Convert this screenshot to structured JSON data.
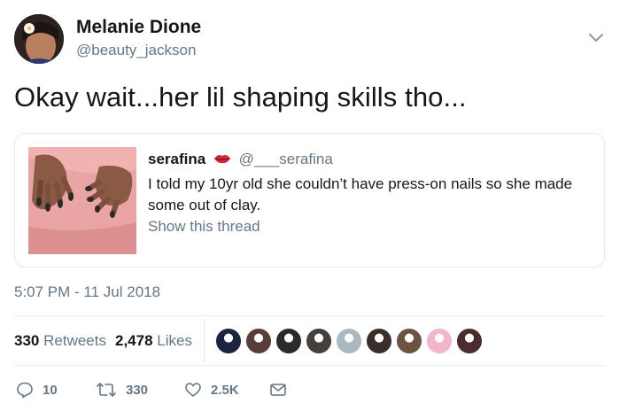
{
  "author": {
    "name": "Melanie Dione",
    "handle": "@beauty_jackson",
    "avatar_icon": "profile-photo"
  },
  "tweet": {
    "text": "Okay wait...her lil shaping skills tho..."
  },
  "quoted": {
    "name": "serafina",
    "emoji_icon": "lips-emoji",
    "handle": "@___serafina",
    "text": "I told my 10yr old she couldn’t have press-on nails so she made some out of clay.",
    "link": "Show this thread",
    "image": "hands-with-clay-nails-photo"
  },
  "timestamp": "5:07 PM - 11 Jul 2018",
  "stats": {
    "retweets_count": "330",
    "retweets_label": "Retweets",
    "likes_count": "2,478",
    "likes_label": "Likes"
  },
  "likers": [
    {
      "color": "#1b2440"
    },
    {
      "color": "#5a3d3a"
    },
    {
      "color": "#2b2b2b"
    },
    {
      "color": "#44403a"
    },
    {
      "color": "#aab8c2"
    },
    {
      "color": "#3a2f2a"
    },
    {
      "color": "#6b5440"
    },
    {
      "color": "#f1b6cc"
    },
    {
      "color": "#4b2c2f"
    }
  ],
  "actions": {
    "reply_count": "10",
    "retweet_count": "330",
    "like_count": "2.5K"
  },
  "colors": {
    "text_primary": "#14171a",
    "text_secondary": "#657786",
    "border": "#e1e8ed"
  }
}
